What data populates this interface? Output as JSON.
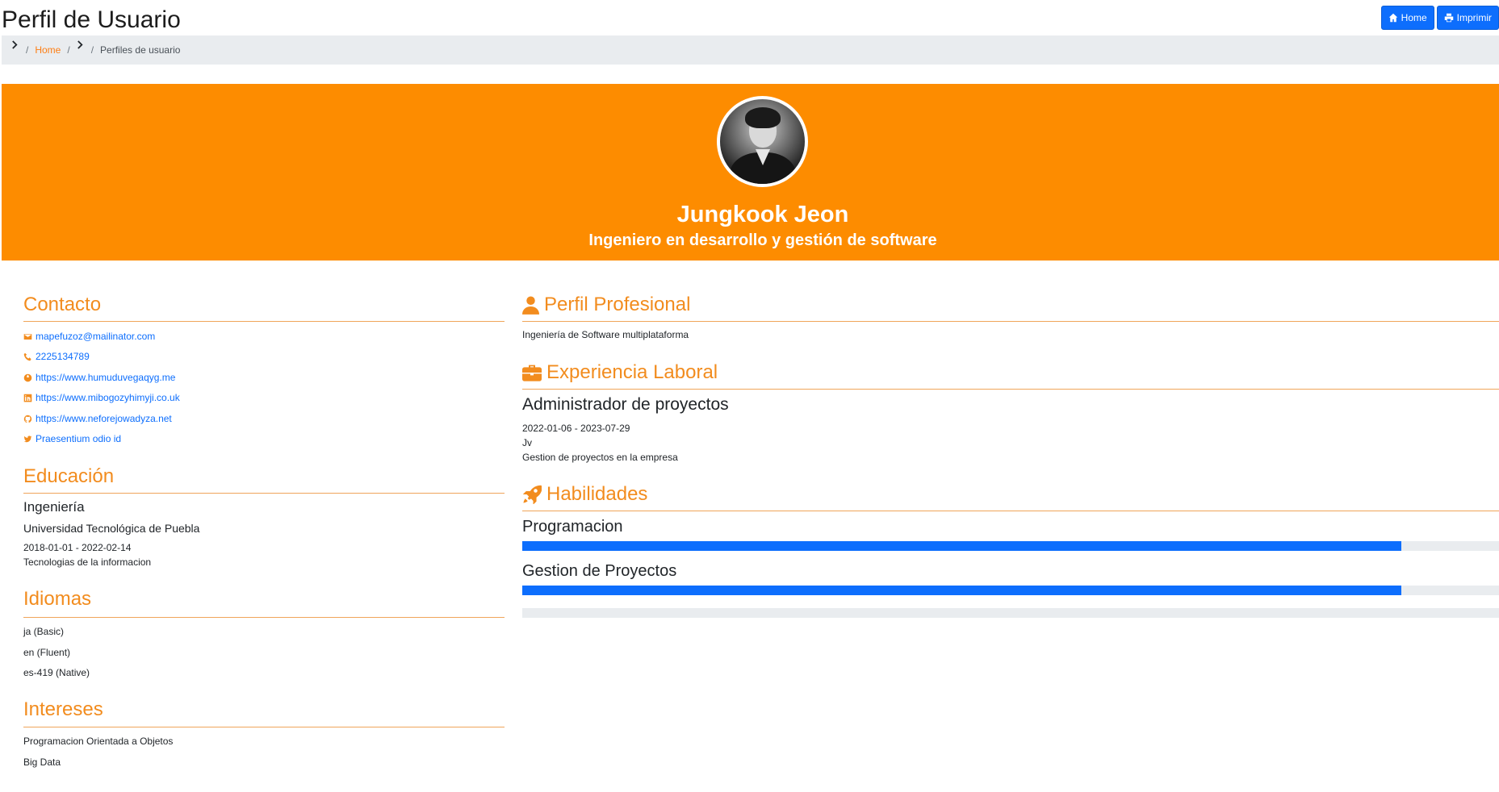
{
  "header": {
    "title": "Perfil de Usuario",
    "home_label": "Home",
    "print_label": "Imprimir"
  },
  "breadcrumb": {
    "home": "Home",
    "current": "Perfiles de usuario"
  },
  "profile": {
    "name": "Jungkook Jeon",
    "role": "Ingeniero en desarrollo y gestión de software"
  },
  "contact": {
    "heading": "Contacto",
    "email": "mapefuzoz@mailinator.com",
    "phone": "2225134789",
    "website": "https://www.humuduvegaqyg.me",
    "linkedin": "https://www.mibogozyhimyji.co.uk",
    "github": "https://www.neforejowadyza.net",
    "twitter": "Praesentium odio id"
  },
  "education": {
    "heading": "Educación",
    "degree": "Ingeniería",
    "school": "Universidad Tecnológica de Puebla",
    "dates": "2018-01-01 - 2022-02-14",
    "field": "Tecnologias de la informacion"
  },
  "languages": {
    "heading": "Idiomas",
    "items": [
      "ja (Basic)",
      "en (Fluent)",
      "es-419 (Native)"
    ]
  },
  "interests": {
    "heading": "Intereses",
    "items": [
      "Programacion Orientada a Objetos",
      "Big Data"
    ]
  },
  "professional_profile": {
    "heading": "Perfil Profesional",
    "text": "Ingeniería de Software multiplataforma"
  },
  "experience": {
    "heading": "Experiencia Laboral",
    "title": "Administrador de proyectos",
    "dates": "2022-01-06 - 2023-07-29",
    "company": "Jv",
    "description": "Gestion de proyectos en la empresa"
  },
  "skills": {
    "heading": "Habilidades",
    "items": [
      {
        "name": "Programacion",
        "level": 0.9
      },
      {
        "name": "Gestion de Proyectos",
        "level": 0.9
      }
    ],
    "extra_bar_level": 0
  },
  "colors": {
    "accent": "#f28c1e",
    "banner": "#fd8c00",
    "primary": "#0d6efd"
  }
}
